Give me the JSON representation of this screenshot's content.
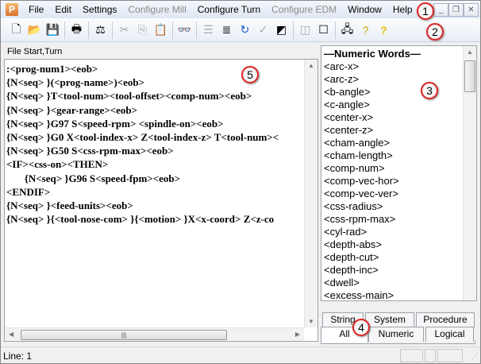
{
  "menubar": {
    "items": [
      {
        "label": "File",
        "enabled": true
      },
      {
        "label": "Edit",
        "enabled": true
      },
      {
        "label": "Settings",
        "enabled": true
      },
      {
        "label": "Configure Mill",
        "enabled": false
      },
      {
        "label": "Configure Turn",
        "enabled": true
      },
      {
        "label": "Configure EDM",
        "enabled": false
      },
      {
        "label": "Window",
        "enabled": true
      },
      {
        "label": "Help",
        "enabled": true
      }
    ]
  },
  "window_buttons": {
    "minimize": "_",
    "restore": "❐",
    "close": "✕"
  },
  "callouts": [
    "1",
    "2",
    "3",
    "4",
    "5"
  ],
  "editor": {
    "label": "File Start,Turn",
    "lines": [
      ":<prog-num1><eob>",
      "{N<seq> }(<prog-name>)<eob>",
      "{N<seq> }T<tool-num><tool-offset><comp-num><eob>",
      "{N<seq> }<gear-range><eob>",
      "{N<seq> }G97 S<speed-rpm> <spindle-on><eob>",
      "{N<seq> }G0 X<tool-index-x> Z<tool-index-z> T<tool-num><",
      "{N<seq> }G50 S<css-rpm-max><eob>",
      "<IF><css-on><THEN>",
      "       {N<seq> }G96 S<speed-fpm><eob>",
      "<ENDIF>",
      "{N<seq> }<feed-units><eob>",
      "{N<seq> }{<tool-nose-com> }{<motion> }X<x-coord> Z<z-co"
    ]
  },
  "wordlist": {
    "items": [
      "—Numeric Words—",
      "<arc-x>",
      "<arc-z>",
      "<b-angle>",
      "<c-angle>",
      "<center-x>",
      "<center-z>",
      "<cham-angle>",
      "<cham-length>",
      "<comp-num>",
      "<comp-vec-hor>",
      "<comp-vec-ver>",
      "<css-radius>",
      "<css-rpm-max>",
      "<cyl-rad>",
      "<depth-abs>",
      "<depth-cut>",
      "<depth-inc>",
      "<dwell>",
      "<excess-main>"
    ]
  },
  "tabs": {
    "back": [
      "String",
      "System",
      "Procedure"
    ],
    "front": [
      "All",
      "Numeric",
      "Logical"
    ],
    "active": "All"
  },
  "status": {
    "line": "Line: 1"
  }
}
